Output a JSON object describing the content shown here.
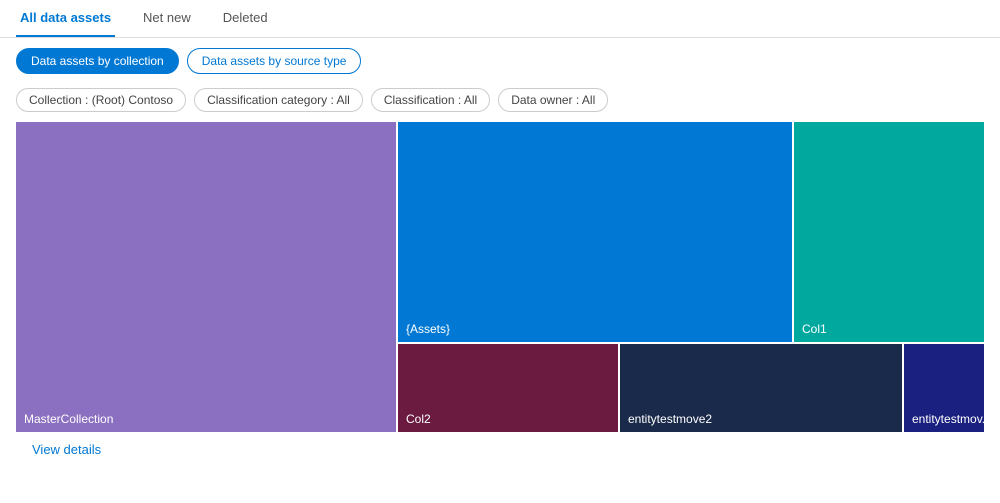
{
  "tabs": [
    {
      "id": "all",
      "label": "All data assets",
      "active": true
    },
    {
      "id": "netnew",
      "label": "Net new",
      "active": false
    },
    {
      "id": "deleted",
      "label": "Deleted",
      "active": false
    }
  ],
  "toolbar": {
    "btn_collection": "Data assets by collection",
    "btn_source": "Data assets by source type"
  },
  "filters": [
    {
      "id": "collection",
      "label": "Collection : (Root) Contoso"
    },
    {
      "id": "classification_category",
      "label": "Classification category : All"
    },
    {
      "id": "classification",
      "label": "Classification : All"
    },
    {
      "id": "data_owner",
      "label": "Data owner : All"
    }
  ],
  "treemap": {
    "cells": [
      {
        "id": "master",
        "label": "MasterCollection",
        "color": "#8b6fc0"
      },
      {
        "id": "assets",
        "label": "{Assets}",
        "color": "#0078d4"
      },
      {
        "id": "col1",
        "label": "Col1",
        "color": "#00a89d"
      },
      {
        "id": "col2",
        "label": "Col2",
        "color": "#6b1a40"
      },
      {
        "id": "entitytestmove2",
        "label": "entitytestmove2",
        "color": "#1a2a4a"
      },
      {
        "id": "entitytestmov",
        "label": "entitytestmov...",
        "color": "#1a2080"
      }
    ]
  },
  "view_details": "View details"
}
